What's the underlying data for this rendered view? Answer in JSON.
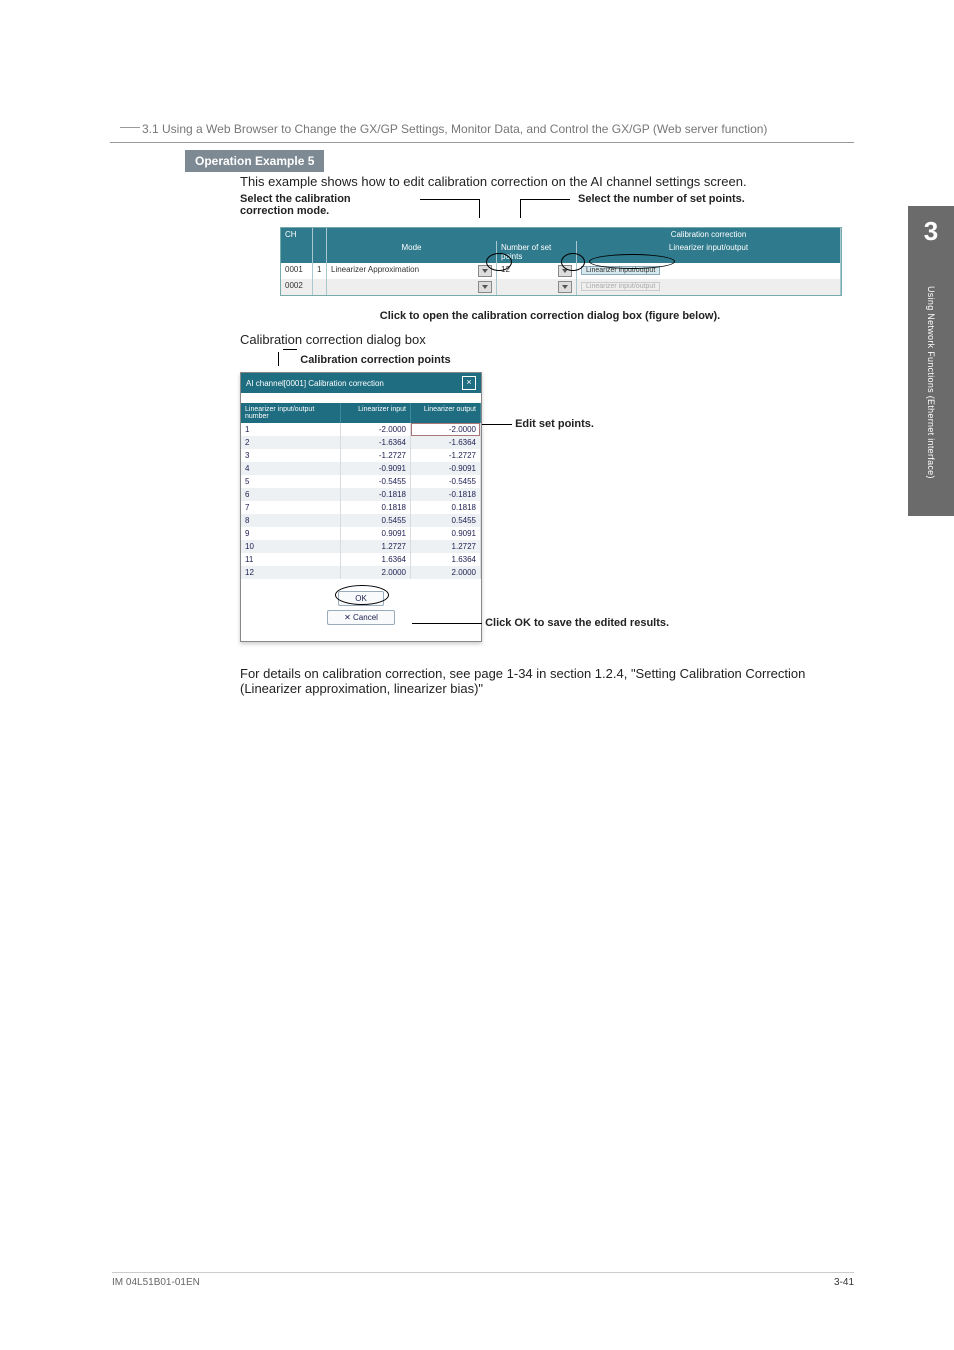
{
  "section_link": "3.1  Using a Web Browser to Change the GX/GP Settings, Monitor Data, and Control the GX/GP (Web server function)",
  "op_title": "Operation Example 5",
  "intro_text": "This example shows how to edit calibration correction on the AI channel settings screen.",
  "callouts": {
    "top_left_l1": "Select the calibration",
    "top_left_l2": "correction mode.",
    "top_right": "Select the number of set points.",
    "click_open": "Click to open the calibration correction dialog box (figure below).",
    "dialog_box_caption": "Calibration correction dialog box",
    "calib_points_label": "Calibration correction points",
    "edit_set_points": "Edit set points.",
    "click_ok": "Click OK to save the edited results."
  },
  "grid_upper": {
    "headers": {
      "ch": "CH",
      "mode": "Mode",
      "num": "Number of set points",
      "lio": "Linearizer input/output"
    },
    "group_label": "Calibration correction",
    "rows": [
      {
        "ch": "0001",
        "n": "1",
        "mode": "Linearizer Approximation",
        "num": "12",
        "lio_btn": "Linearizer input/output"
      },
      {
        "ch": "0002",
        "n": "",
        "mode": "",
        "num": "",
        "lio_btn": "Linearizer input/output"
      }
    ]
  },
  "dialog": {
    "title": "AI channel[0001] Calibration correction",
    "header": {
      "num": "Linearizer input/output number",
      "in": "Linearizer input",
      "out": "Linearizer output"
    },
    "rows": [
      {
        "n": "1",
        "in": "-2.0000",
        "out": "-2.0000"
      },
      {
        "n": "2",
        "in": "-1.6364",
        "out": "-1.6364"
      },
      {
        "n": "3",
        "in": "-1.2727",
        "out": "-1.2727"
      },
      {
        "n": "4",
        "in": "-0.9091",
        "out": "-0.9091"
      },
      {
        "n": "5",
        "in": "-0.5455",
        "out": "-0.5455"
      },
      {
        "n": "6",
        "in": "-0.1818",
        "out": "-0.1818"
      },
      {
        "n": "7",
        "in": "0.1818",
        "out": "0.1818"
      },
      {
        "n": "8",
        "in": "0.5455",
        "out": "0.5455"
      },
      {
        "n": "9",
        "in": "0.9091",
        "out": "0.9091"
      },
      {
        "n": "10",
        "in": "1.2727",
        "out": "1.2727"
      },
      {
        "n": "11",
        "in": "1.6364",
        "out": "1.6364"
      },
      {
        "n": "12",
        "in": "2.0000",
        "out": "2.0000"
      }
    ],
    "ok_label": "OK",
    "cancel_label": "Cancel"
  },
  "end_para": "For details on calibration correction, see page 1-34 in section 1.2.4, \"Setting Calibration Correction (Linearizer approximation, linearizer bias)\"",
  "thumb": {
    "chapter": "3",
    "side_label": "Using Network Functions (Ethernet interface)"
  },
  "footer": {
    "manual_id": "IM 04L51B01-01EN",
    "page_num": "3-41"
  }
}
